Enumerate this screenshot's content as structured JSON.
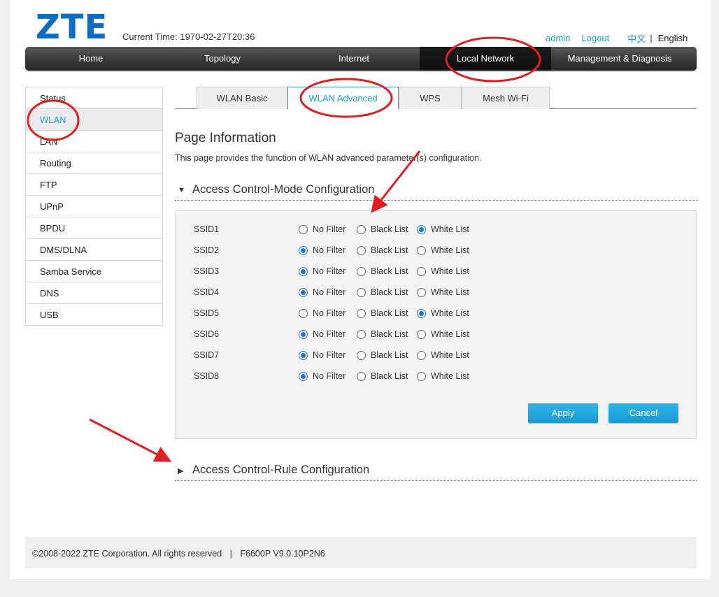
{
  "header": {
    "logo": "ZTE",
    "current_time_label": "Current Time:",
    "current_time_value": "1970-02-27T20:36",
    "admin": "admin",
    "logout": "Logout",
    "lang_cn": "中文",
    "lang_sep": "|",
    "lang_en": "English"
  },
  "main_nav": [
    "Home",
    "Topology",
    "Internet",
    "Local Network",
    "Management & Diagnosis"
  ],
  "sidebar": [
    "Status",
    "WLAN",
    "LAN",
    "Routing",
    "FTP",
    "UPnP",
    "BPDU",
    "DMS/DLNA",
    "Samba Service",
    "DNS",
    "USB"
  ],
  "tabs": [
    "WLAN Basic",
    "WLAN Advanced",
    "WPS",
    "Mesh Wi-Fi"
  ],
  "page_info": {
    "title": "Page Information",
    "description": "This page provides the function of WLAN advanced parameter(s) configuration."
  },
  "section_mode": {
    "title": "Access Control-Mode Configuration",
    "options": [
      "No Filter",
      "Black List",
      "White List"
    ],
    "rows": [
      {
        "ssid": "SSID1",
        "selected": "White List"
      },
      {
        "ssid": "SSID2",
        "selected": "No Filter"
      },
      {
        "ssid": "SSID3",
        "selected": "No Filter"
      },
      {
        "ssid": "SSID4",
        "selected": "No Filter"
      },
      {
        "ssid": "SSID5",
        "selected": "White List"
      },
      {
        "ssid": "SSID6",
        "selected": "No Filter"
      },
      {
        "ssid": "SSID7",
        "selected": "No Filter"
      },
      {
        "ssid": "SSID8",
        "selected": "No Filter"
      }
    ],
    "apply": "Apply",
    "cancel": "Cancel"
  },
  "section_rule": {
    "title": "Access Control-Rule Configuration"
  },
  "footer": {
    "copyright": "©2008-2022 ZTE Corporation. All rights reserved",
    "sep": "|",
    "version": "F6600P V9.0.10P2N6"
  },
  "colors": {
    "accent": "#199fd6",
    "logo": "#0c6bc2",
    "annotation": "#e02020"
  }
}
